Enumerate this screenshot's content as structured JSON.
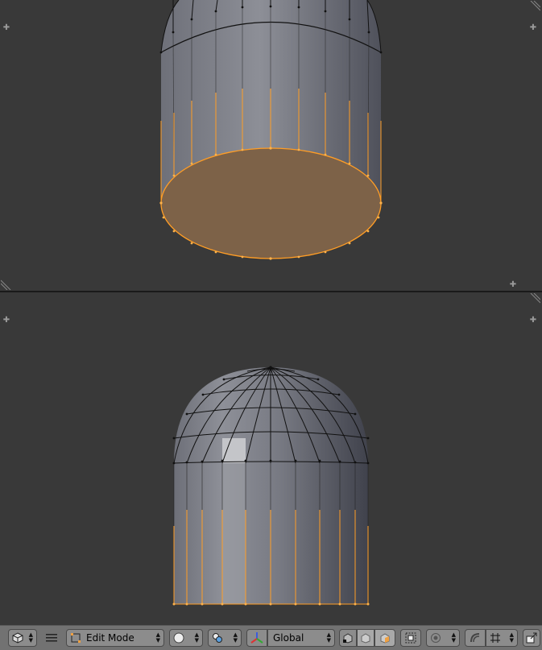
{
  "header": {
    "mode_label": "Edit Mode",
    "orientation_label": "Global",
    "icons": [
      "cube-view-icon",
      "menu-icon",
      "edit-mode-icon",
      "solid-shading-icon",
      "pivot-icon",
      "manipulator-icon",
      "vertex-select-icon",
      "edge-select-icon",
      "face-select-icon",
      "limit-selection-icon",
      "proportional-edit-icon",
      "snap-icon",
      "snap-target-icon",
      "render-icon"
    ]
  },
  "colors": {
    "viewport_bg": "#393939",
    "selected_edge": "#ff9d25",
    "selected_face": "#7d6248",
    "header_bg": "#727272"
  }
}
